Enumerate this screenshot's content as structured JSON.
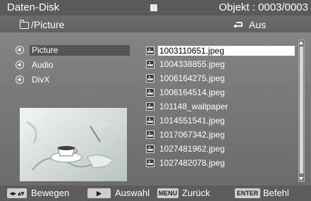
{
  "header": {
    "title": "Daten-Disk",
    "objekt": "Objekt : 0003/0003",
    "stop_icon": "stop-icon"
  },
  "pathbar": {
    "path": "/Picture",
    "repeat": "Aus",
    "folder_icon": "folder-icon",
    "repeat_icon": "repeat-icon"
  },
  "categories": [
    {
      "label": "Picture",
      "selected": true
    },
    {
      "label": "Audio",
      "selected": false
    },
    {
      "label": "DivX",
      "selected": false
    }
  ],
  "files": [
    {
      "name": "1003110651.jpeg",
      "selected": true
    },
    {
      "name": "1004338855.jpeg",
      "selected": false
    },
    {
      "name": "1006164275.jpeg",
      "selected": false
    },
    {
      "name": "1006164514.jpeg",
      "selected": false
    },
    {
      "name": "101148_wallpaper",
      "selected": false
    },
    {
      "name": "1014551541.jpeg",
      "selected": false
    },
    {
      "name": "1017067342.jpeg",
      "selected": false
    },
    {
      "name": "1027481962.jpeg",
      "selected": false
    },
    {
      "name": "1027482078.jpeg",
      "selected": false
    }
  ],
  "footer": {
    "move_key": "◂▸ ▴▾",
    "move_label": "Bewegen",
    "select_key": "▶",
    "select_label": "Auswahl",
    "menu_key": "MENU",
    "menu_label": "Zurück",
    "enter_key": "ENTER",
    "enter_label": "Befehl"
  },
  "colors": {
    "background": "#7a7a7a",
    "header": "#5a5a5a",
    "selection_left": "#555555",
    "selection_right": "#ffffff"
  }
}
